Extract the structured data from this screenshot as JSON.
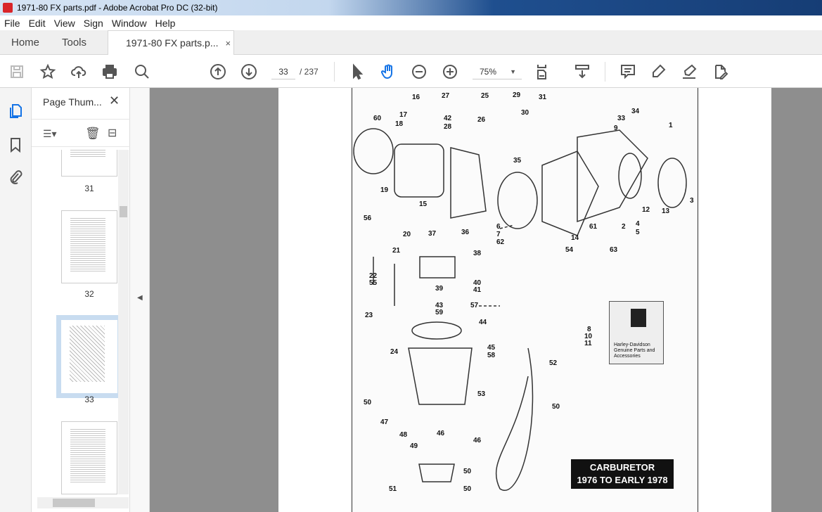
{
  "window": {
    "title": "1971-80 FX parts.pdf - Adobe Acrobat Pro DC (32-bit)"
  },
  "menu": [
    "File",
    "Edit",
    "View",
    "Sign",
    "Window",
    "Help"
  ],
  "tabs": {
    "home": "Home",
    "tools": "Tools",
    "document": "1971-80 FX parts.p...",
    "close": "×"
  },
  "toolbar": {
    "page_current": "33",
    "page_total": "/ 237",
    "zoom": "75%",
    "active_tool": "hand"
  },
  "sidebar": {
    "panel_title": "Page Thum...",
    "close": "✕",
    "thumbnails": [
      {
        "label": "31"
      },
      {
        "label": "32"
      },
      {
        "label": "33",
        "selected": true
      },
      {
        "label": ""
      }
    ]
  },
  "document": {
    "caption_line1": "CARBURETOR",
    "caption_line2": "1976 TO EARLY 1978",
    "box_text": "Harley-Davidson Genuine Parts and Accessories",
    "callouts": [
      "16",
      "27",
      "25",
      "29",
      "31",
      "17",
      "42",
      "26",
      "30",
      "33",
      "34",
      "60",
      "18",
      "28",
      "9",
      "1",
      "35",
      "19",
      "15",
      "12",
      "13",
      "3",
      "56",
      "6",
      "7",
      "62",
      "14",
      "61",
      "2",
      "4",
      "5",
      "37",
      "36",
      "20",
      "63",
      "21",
      "38",
      "54",
      "22",
      "55",
      "40",
      "41",
      "39",
      "43",
      "59",
      "57",
      "23",
      "44",
      "8",
      "10",
      "11",
      "24",
      "45",
      "58",
      "52",
      "50",
      "53",
      "50",
      "47",
      "46",
      "48",
      "46",
      "49",
      "50",
      "51",
      "50"
    ]
  },
  "colors": {
    "accent": "#1473e6",
    "viewport_bg": "#8e8e8e"
  }
}
